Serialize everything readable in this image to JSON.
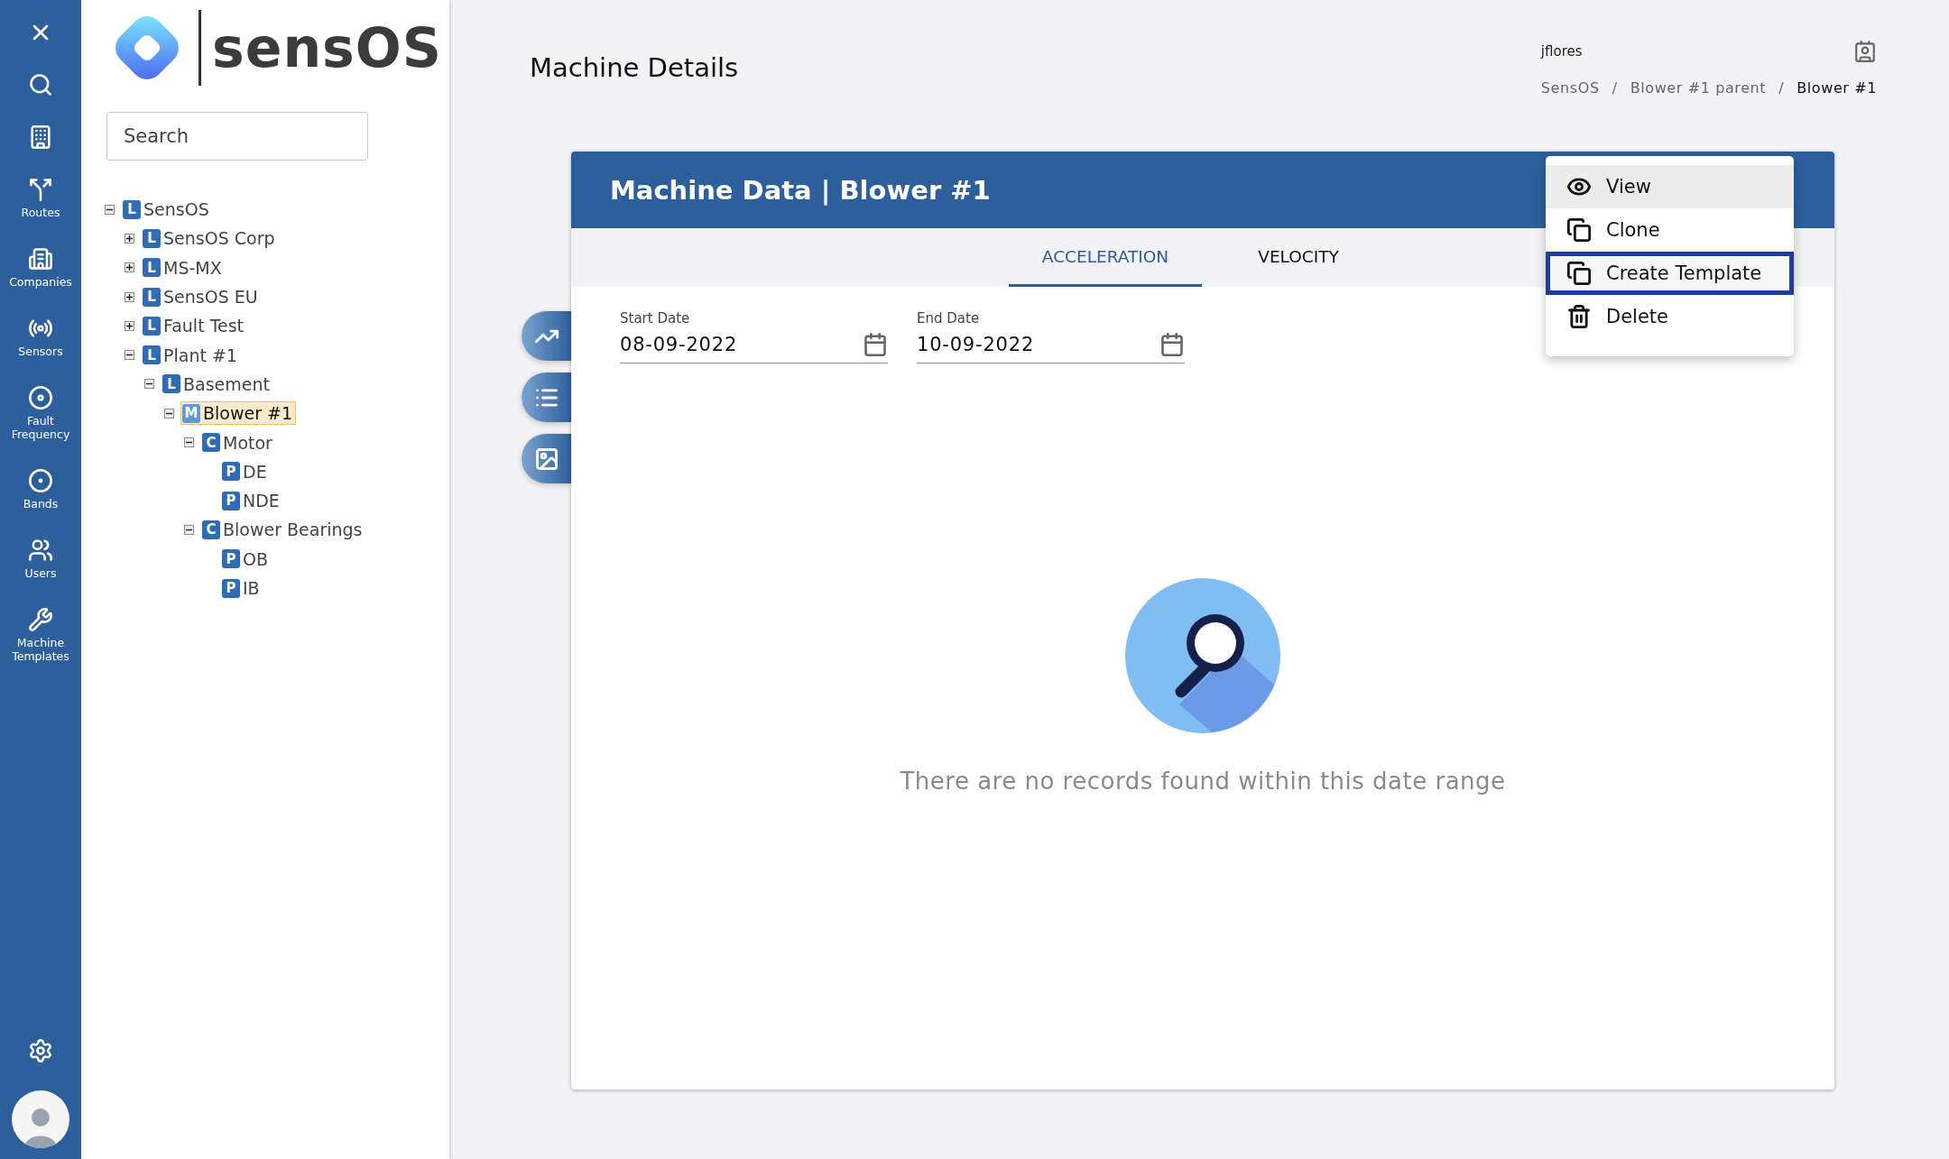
{
  "rail": {
    "top": [
      {
        "kind": "close"
      },
      {
        "kind": "search"
      },
      {
        "kind": "buildings"
      },
      {
        "kind": "routes",
        "label": "Routes"
      },
      {
        "kind": "companies",
        "label": "Companies"
      },
      {
        "kind": "sensors",
        "label": "Sensors"
      },
      {
        "kind": "fault",
        "label": "Fault Frequency"
      },
      {
        "kind": "bands",
        "label": "Bands"
      },
      {
        "kind": "users",
        "label": "Users"
      },
      {
        "kind": "wrench",
        "label": "Machine Templates"
      }
    ],
    "bottom": [
      {
        "kind": "settings"
      },
      {
        "kind": "avatar"
      }
    ]
  },
  "brand": {
    "name": "sensOS"
  },
  "search": {
    "placeholder": "Search"
  },
  "tree": [
    {
      "type": "L",
      "label": "SensOS",
      "expanded": true,
      "selected": false,
      "children": [
        {
          "type": "L",
          "label": "SensOS Corp",
          "expanded": false,
          "selected": false
        },
        {
          "type": "L",
          "label": "MS-MX",
          "expanded": false,
          "selected": false
        },
        {
          "type": "L",
          "label": "SensOS EU",
          "expanded": false,
          "selected": false
        },
        {
          "type": "L",
          "label": "Fault Test",
          "expanded": false,
          "selected": false
        },
        {
          "type": "L",
          "label": "Plant #1",
          "expanded": true,
          "selected": false,
          "children": [
            {
              "type": "L",
              "label": "Basement",
              "expanded": true,
              "selected": false,
              "children": [
                {
                  "type": "M",
                  "label": "Blower #1",
                  "expanded": true,
                  "selected": true,
                  "children": [
                    {
                      "type": "C",
                      "label": "Motor",
                      "expanded": true,
                      "selected": false,
                      "children": [
                        {
                          "type": "P",
                          "label": "DE",
                          "selected": false
                        },
                        {
                          "type": "P",
                          "label": "NDE",
                          "selected": false
                        }
                      ]
                    },
                    {
                      "type": "C",
                      "label": "Blower Bearings",
                      "expanded": true,
                      "selected": false,
                      "children": [
                        {
                          "type": "P",
                          "label": "OB",
                          "selected": false
                        },
                        {
                          "type": "P",
                          "label": "IB",
                          "selected": false
                        }
                      ]
                    }
                  ]
                }
              ]
            }
          ]
        }
      ]
    }
  ],
  "page": {
    "title": "Machine Details",
    "user": "jflores",
    "separator": "/",
    "breadcrumb": [
      {
        "label": "SensOS",
        "current": false
      },
      {
        "label": "Blower #1 parent",
        "current": false
      },
      {
        "label": "Blower #1",
        "current": true
      }
    ]
  },
  "side_buttons": [
    {
      "kind": "chart"
    },
    {
      "kind": "list"
    },
    {
      "kind": "image"
    }
  ],
  "card": {
    "title": "Machine Data | Blower #1",
    "tabs": [
      {
        "label": "ACCELERATION",
        "selected": true
      },
      {
        "label": "VELOCITY",
        "selected": false
      }
    ],
    "fields": [
      {
        "label": "Start Date",
        "value": "08-09-2022"
      },
      {
        "label": "End Date",
        "value": "10-09-2022"
      }
    ],
    "empty_message": "There are no records found within this date range"
  },
  "menu": [
    {
      "kind": "view",
      "label": "View",
      "hovered": true,
      "focused": false
    },
    {
      "kind": "copy",
      "label": "Clone",
      "hovered": false,
      "focused": false
    },
    {
      "kind": "copy",
      "label": "Create Template",
      "hovered": false,
      "focused": true
    },
    {
      "kind": "trash",
      "label": "Delete",
      "hovered": false,
      "focused": false
    }
  ]
}
